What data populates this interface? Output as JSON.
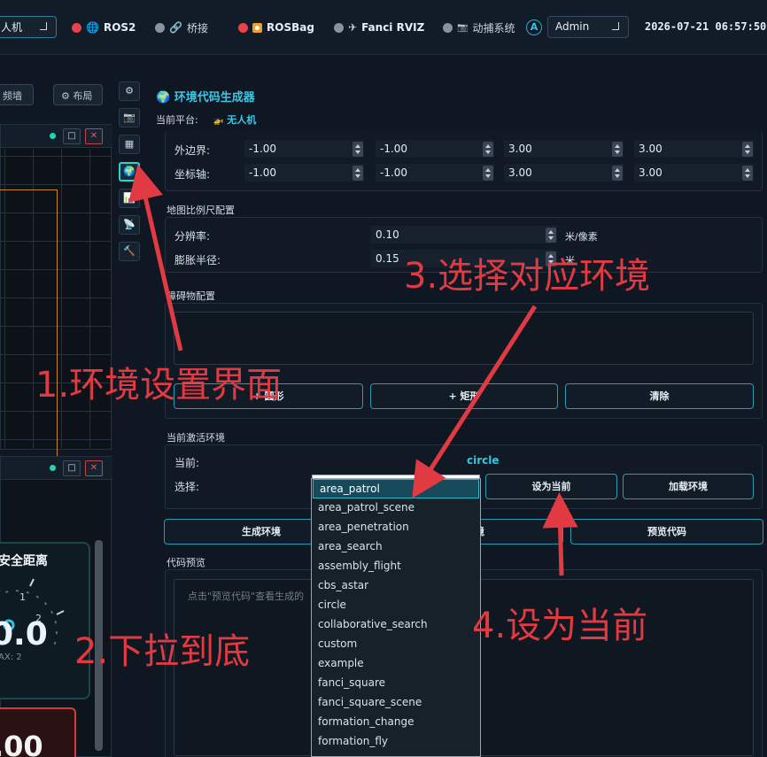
{
  "topbar": {
    "vehicle_select": "人机",
    "items": [
      {
        "label": "ROS2",
        "dot_color": "#e8434b",
        "icon": "globe-icon"
      },
      {
        "label": "桥接",
        "dot_color": "#8a939c",
        "icon": "link-icon"
      },
      {
        "label": "ROSBag",
        "dot_color": "#e8434b",
        "icon": "record-icon"
      },
      {
        "label": "Fanci RVIZ",
        "dot_color": "#8a939c",
        "icon": "plane-icon"
      },
      {
        "label": "动捕系统",
        "dot_color": "#8a939c",
        "icon": "camera-icon"
      }
    ],
    "avatar": "A",
    "user_select": "Admin",
    "datetime": "2026-07-21 06:57:50"
  },
  "left": {
    "video_wall_button": "频墙",
    "layout_button": "⚙ 布局",
    "gauge_label": "安全距离",
    "gauge_value": "0.0",
    "gauge_max": "AX: 2",
    "gauge_tick_1": "1",
    "gauge_tick_2": "2",
    "red_value": ".00"
  },
  "main": {
    "title": "环境代码生成器",
    "platform_label": "当前平台:",
    "platform_value": "无人机",
    "bounds": {
      "outer_label": "外边界:",
      "outer_values": [
        "-1.00",
        "-1.00",
        "3.00",
        "3.00"
      ],
      "axis_label": "坐标轴:",
      "axis_values": [
        "-1.00",
        "-1.00",
        "3.00",
        "3.00"
      ]
    },
    "scale": {
      "title": "地图比例尺配置",
      "resolution_label": "分辨率:",
      "resolution_value": "0.10",
      "resolution_unit": "米/像素",
      "inflation_label": "膨胀半径:",
      "inflation_value": "0.15",
      "inflation_unit": "米"
    },
    "obstacles": {
      "title": "障碍物配置",
      "circle_button": "+ 圆形",
      "rect_button": "+ 矩形",
      "clear_button": "清除"
    },
    "active_env": {
      "title": "当前激活环境",
      "current_label": "当前:",
      "current_value": "circle",
      "select_label": "选择:",
      "set_current_button": "设为当前",
      "load_button": "加载环境"
    },
    "generate_button": "生成环境",
    "save_button": "境",
    "preview_button": "预览代码",
    "code_preview": {
      "title": "代码预览",
      "placeholder": "点击\"预览代码\"查看生成的"
    }
  },
  "dropdown": {
    "selected": "area_patrol",
    "options": [
      "area_patrol",
      "area_patrol_scene",
      "area_penetration",
      "area_search",
      "assembly_flight",
      "cbs_astar",
      "circle",
      "collaborative_search",
      "custom",
      "example",
      "fanci_square",
      "fanci_square_scene",
      "formation_change",
      "formation_fly"
    ]
  },
  "annotations": {
    "step1": "1.环境设置界面",
    "step2": "2.下拉到底",
    "step3": "3.选择对应环境",
    "step4": "4.设为当前"
  },
  "colors": {
    "accent": "#3cc7e6",
    "annotation": "#e23a42",
    "active_icon": "#2ed3c6"
  }
}
